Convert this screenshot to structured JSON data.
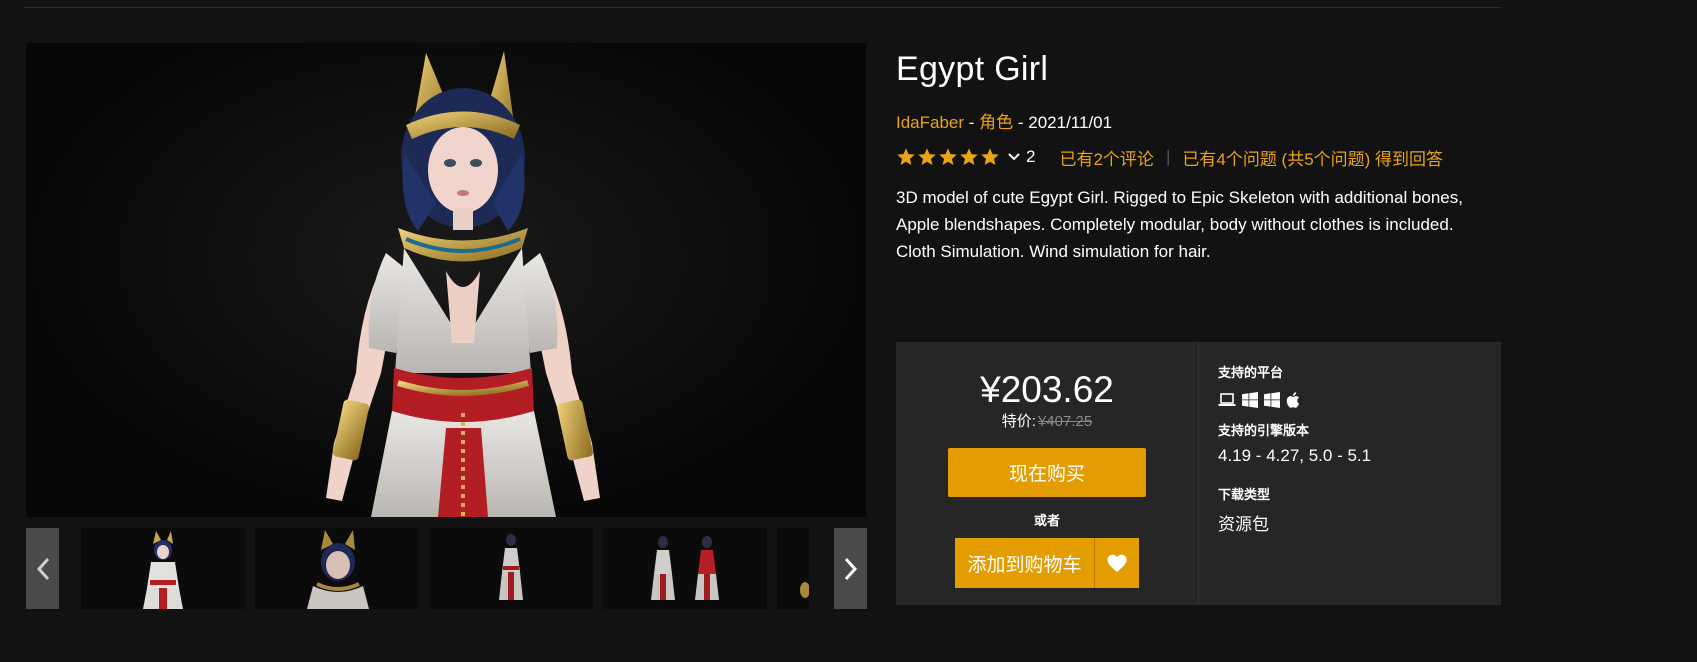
{
  "product": {
    "title": "Egypt Girl",
    "seller": "IdaFaber",
    "meta_sep1": " - ",
    "category": "角色",
    "meta_sep2": " - ",
    "date": "2021/11/01",
    "rating_stars": 5,
    "rating_count": "2",
    "reviews_link": "已有2个评论",
    "questions_link": "已有4个问题 (共5个问题) 得到回答",
    "rating_separator": "|",
    "description": "3D model of cute Egypt Girl. Rigged to Epic Skeleton with additional bones, Apple blendshapes. Completely modular, body without clothes is included. Cloth Simulation. Wind simulation for hair."
  },
  "purchase": {
    "price": "¥203.62",
    "sale_label": "特价:",
    "original_price": "¥407.25",
    "buy_now_label": "现在购买",
    "or_label": "或者",
    "add_to_cart_label": "添加到购物车"
  },
  "info": {
    "platforms_heading": "支持的平台",
    "platform_icons": [
      "laptop-icon",
      "windows-icon",
      "windows-icon",
      "apple-icon"
    ],
    "engine_heading": "支持的引擎版本",
    "engine_versions": "4.19 - 4.27, 5.0 - 5.1",
    "download_heading": "下载类型",
    "download_type": "资源包"
  },
  "gallery": {
    "thumbnail_count": 5,
    "active_thumbnail": 0
  },
  "colors": {
    "accent": "#e39d00",
    "link": "#e8a317",
    "background": "#121212",
    "panel": "#262626",
    "nav_button": "#4a4a4a"
  }
}
